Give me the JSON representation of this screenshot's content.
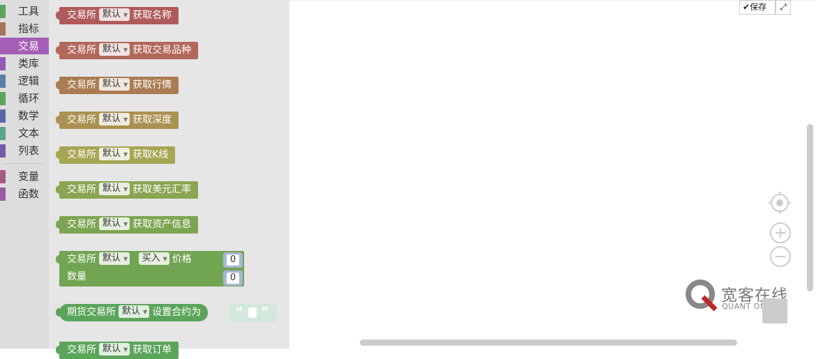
{
  "toolbox": {
    "categories": [
      {
        "label": "工具",
        "color": "#5aa55a"
      },
      {
        "label": "指标",
        "color": "#a5745b"
      },
      {
        "label": "交易",
        "color": "#a55eb8"
      },
      {
        "label": "类库",
        "color": "#9158b8"
      },
      {
        "label": "逻辑",
        "color": "#5b80a5"
      },
      {
        "label": "循环",
        "color": "#5ba55b"
      },
      {
        "label": "数学",
        "color": "#5b67a5"
      },
      {
        "label": "文本",
        "color": "#5ba58c"
      },
      {
        "label": "列表",
        "color": "#745ba5"
      },
      {
        "label": "变量",
        "color": "#a55b80"
      },
      {
        "label": "函数",
        "color": "#9a5ba5"
      }
    ],
    "active": "交易"
  },
  "flyout": {
    "blocks": [
      {
        "prefix": "交易所",
        "exchange": "默认",
        "action": "获取名称",
        "color": "#b15a5a"
      },
      {
        "prefix": "交易所",
        "exchange": "默认",
        "action": "获取交易品种",
        "color": "#b1675a"
      },
      {
        "prefix": "交易所",
        "exchange": "默认",
        "action": "获取行情",
        "color": "#ab7b51"
      },
      {
        "prefix": "交易所",
        "exchange": "默认",
        "action": "获取深度",
        "color": "#ab9151"
      },
      {
        "prefix": "交易所",
        "exchange": "默认",
        "action": "获取K线",
        "color": "#a6a552"
      },
      {
        "prefix": "交易所",
        "exchange": "默认",
        "action": "获取美元汇率",
        "color": "#8aa552"
      },
      {
        "prefix": "交易所",
        "exchange": "默认",
        "action": "获取资产信息",
        "color": "#7ca552"
      }
    ],
    "order_block": {
      "prefix": "交易所",
      "exchange": "默认",
      "side": "买入",
      "price_label": "价格",
      "qty_label": "数量",
      "price_value": "0",
      "qty_value": "0",
      "color": "#71a552"
    },
    "futures_block": {
      "prefix": "期货交易所",
      "exchange": "默认",
      "action": "设置合约为",
      "string_open": "“",
      "string_close": "”",
      "color": "#5ba55b"
    },
    "partial_block": {
      "prefix": "交易所",
      "exchange": "默认",
      "action": "获取订单",
      "color": "#5ba55b"
    }
  },
  "workspace": {
    "save_label": "保存",
    "watermark": {
      "title": "宽客在线",
      "subtitle": "QUANT ON-LINE"
    }
  }
}
